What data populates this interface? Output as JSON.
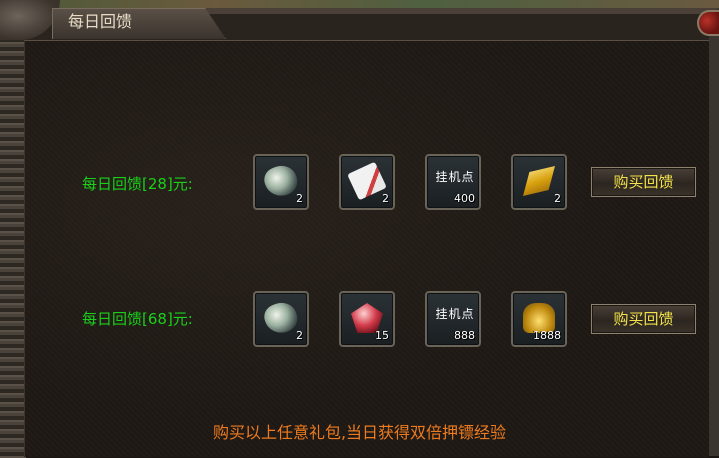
{
  "window": {
    "title": "每日回馈"
  },
  "rows": [
    {
      "label": "每日回馈[28]元:",
      "items": [
        {
          "icon": "gem-icon",
          "qty": "2"
        },
        {
          "icon": "ticket-icon",
          "qty": "2"
        },
        {
          "icon": "afk-points-icon",
          "qty": "400",
          "icon_text": "挂机点"
        },
        {
          "icon": "gold-bar-icon",
          "qty": "2"
        }
      ],
      "button": "购买回馈"
    },
    {
      "label": "每日回馈[68]元:",
      "items": [
        {
          "icon": "gem-icon",
          "qty": "2"
        },
        {
          "icon": "ruby-icon",
          "qty": "15"
        },
        {
          "icon": "afk-points-icon",
          "qty": "888",
          "icon_text": "挂机点"
        },
        {
          "icon": "gold-ingots-icon",
          "qty": "1888"
        }
      ],
      "button": "购买回馈"
    }
  ],
  "notice": "购买以上任意礼包,当日获得双倍押镖经验",
  "colors": {
    "label_green": "#19d119",
    "button_text_yellow": "#f3e24a",
    "notice_orange": "#ee7b1e"
  }
}
